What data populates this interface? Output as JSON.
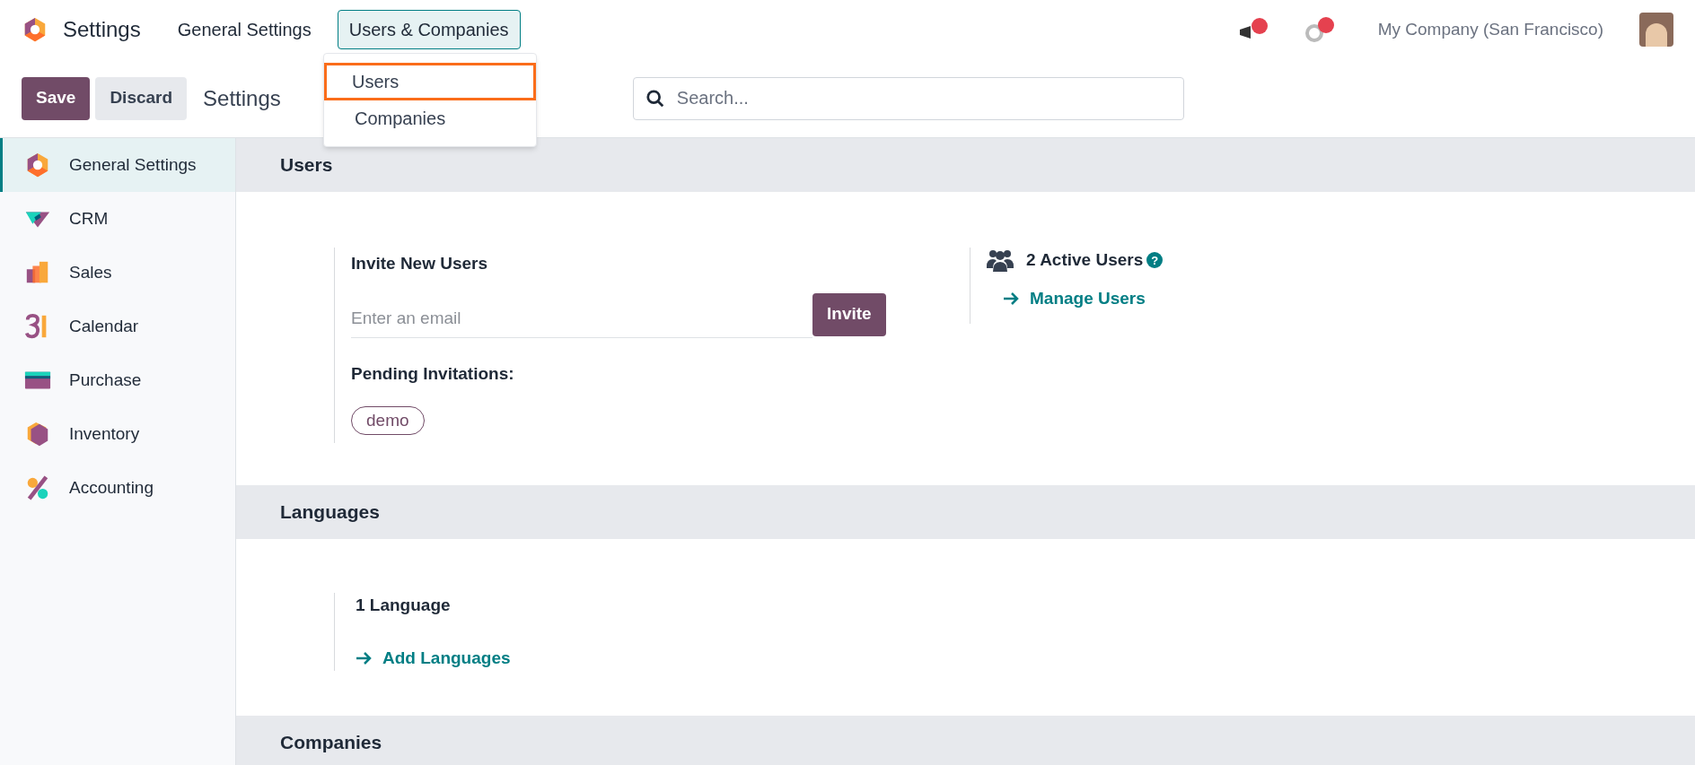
{
  "topbar": {
    "app_title": "Settings",
    "menu": [
      {
        "label": "General Settings",
        "selected": false
      },
      {
        "label": "Users & Companies",
        "selected": true
      }
    ],
    "company": "My Company (San Francisco)"
  },
  "dropdown": {
    "items": [
      {
        "label": "Users",
        "highlighted": true
      },
      {
        "label": "Companies",
        "highlighted": false
      }
    ]
  },
  "control_panel": {
    "save": "Save",
    "discard": "Discard",
    "breadcrumb": "Settings",
    "search": {
      "placeholder": "Search..."
    }
  },
  "sidebar": {
    "items": [
      {
        "label": "General Settings",
        "kind": "settings",
        "selected": true
      },
      {
        "label": "CRM",
        "kind": "crm",
        "selected": false
      },
      {
        "label": "Sales",
        "kind": "sales",
        "selected": false
      },
      {
        "label": "Calendar",
        "kind": "calendar",
        "selected": false
      },
      {
        "label": "Purchase",
        "kind": "purchase",
        "selected": false
      },
      {
        "label": "Inventory",
        "kind": "inventory",
        "selected": false
      },
      {
        "label": "Accounting",
        "kind": "accounting",
        "selected": false
      }
    ]
  },
  "sections": [
    {
      "title": "Users",
      "kind": "users",
      "invite": {
        "title": "Invite New Users",
        "placeholder": "Enter an email",
        "button": "Invite",
        "pending_label": "Pending Invitations:",
        "pending": [
          "demo"
        ]
      },
      "active_users": "2 Active Users",
      "help": "?",
      "link": "Manage Users"
    },
    {
      "title": "Languages",
      "kind": "languages",
      "count": "1 Language",
      "link": "Add Languages"
    },
    {
      "title": "Companies",
      "kind": "header"
    }
  ]
}
